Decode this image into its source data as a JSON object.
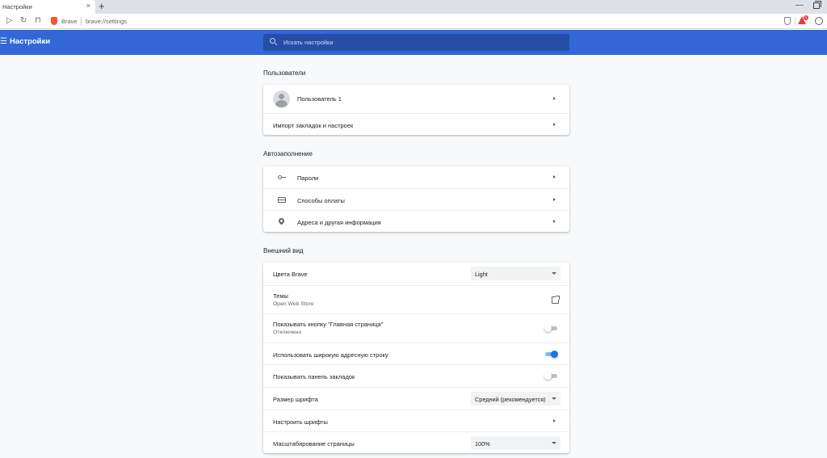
{
  "browser": {
    "tab_title": "Настройки",
    "tab_close": "×",
    "new_tab": "+",
    "brand": "Brave",
    "url": "brave://settings",
    "notification_count": "1",
    "colors": {
      "header": "#3367d6",
      "search_bg": "#254fa6",
      "toggle_on": "#1a73e8",
      "rewards": "#e8413b"
    }
  },
  "header": {
    "title": "Настройки",
    "search_placeholder": "Искать настройки"
  },
  "users": {
    "title": "Пользователи",
    "profile_name": "Пользователь 1",
    "import_label": "Импорт закладок и настроек"
  },
  "autofill": {
    "title": "Автозаполнение",
    "passwords": "Пароли",
    "payment": "Способы оплаты",
    "addresses": "Адреса и другая информация"
  },
  "appearance": {
    "title": "Внешний вид",
    "colors_label": "Цвета Brave",
    "colors_value": "Light",
    "themes_label": "Темы",
    "themes_sub": "Open Web Store",
    "home_button_label": "Показывать кнопку \"Главная страница\"",
    "home_button_sub": "Отключено",
    "home_button_on": false,
    "wide_address_label": "Использовать широкую адресную строку",
    "wide_address_on": true,
    "bookmarks_bar_label": "Показывать панель закладок",
    "bookmarks_bar_on": false,
    "font_size_label": "Размер шрифта",
    "font_size_value": "Средний (рекомендуется)",
    "customize_fonts_label": "Настроить шрифты",
    "zoom_label": "Масштабирование страницы",
    "zoom_value": "100%"
  }
}
